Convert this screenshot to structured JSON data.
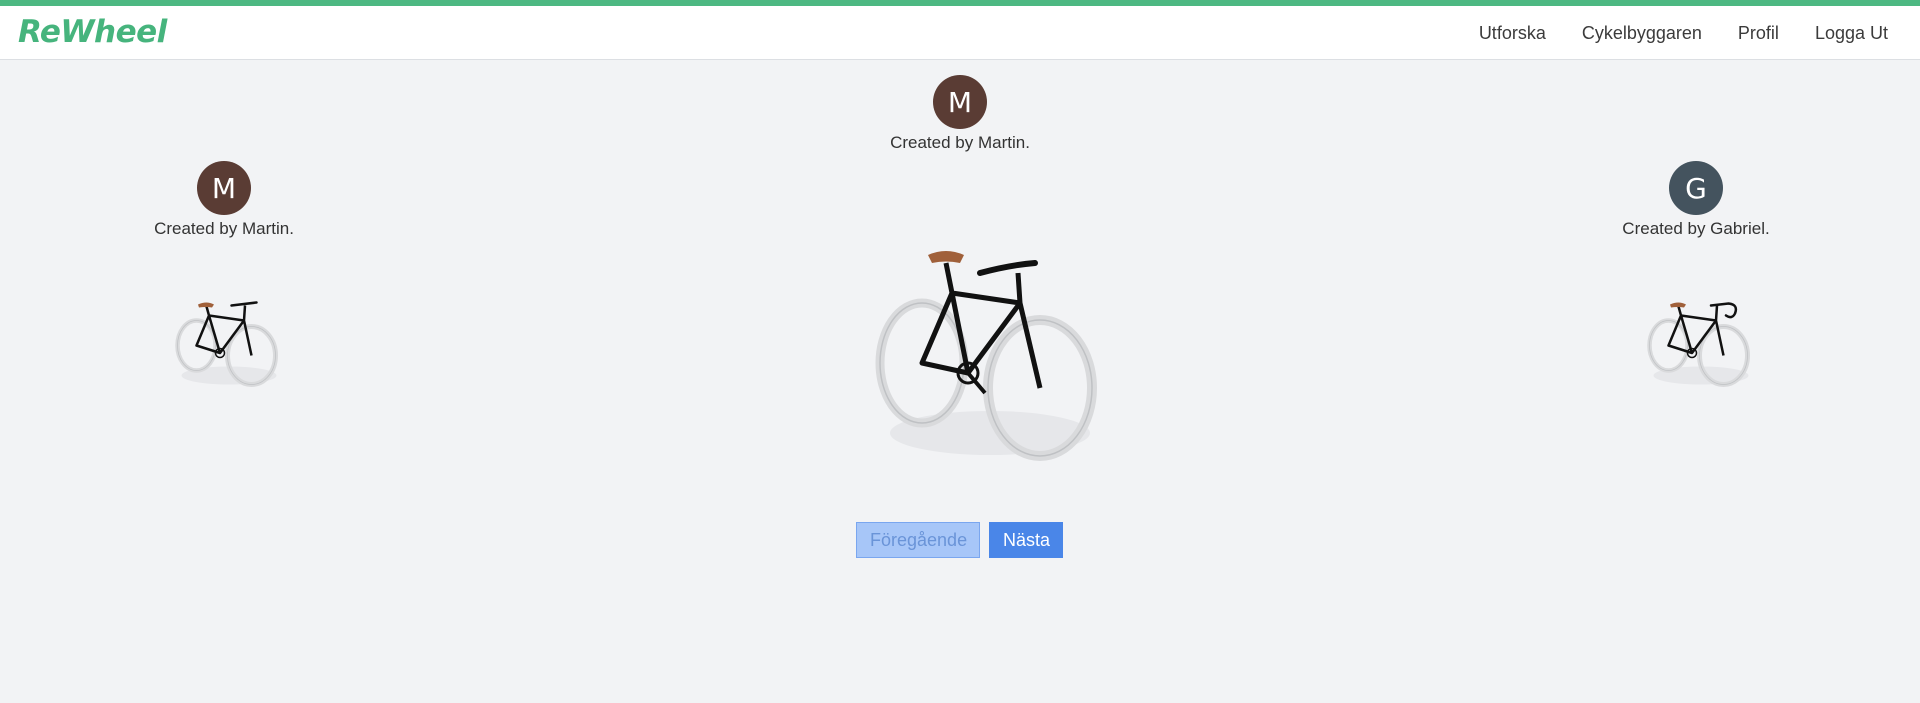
{
  "app": {
    "brand": "ReWheel",
    "accent_color": "#4db882"
  },
  "nav": {
    "items": [
      {
        "label": "Utforska"
      },
      {
        "label": "Cykelbyggaren"
      },
      {
        "label": "Profil"
      },
      {
        "label": "Logga Ut"
      }
    ]
  },
  "carousel": {
    "left": {
      "initial": "M",
      "caption": "Created by Martin.",
      "avatar_color": "#5a3c34"
    },
    "center": {
      "initial": "M",
      "caption": "Created by Martin.",
      "avatar_color": "#5a3c34"
    },
    "right": {
      "initial": "G",
      "caption": "Created by Gabriel.",
      "avatar_color": "#44535e"
    }
  },
  "controls": {
    "prev_label": "Föregående",
    "next_label": "Nästa"
  }
}
